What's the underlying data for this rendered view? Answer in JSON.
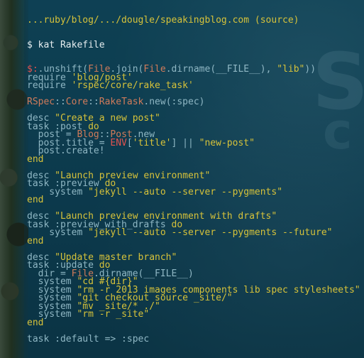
{
  "terminal": {
    "top_line": "...ruby/blog/.../dougle/speakingblog.com (source)",
    "prompt": "$ kat Rakefile",
    "lines": [
      "$:.unshift(File.join(File.dirname(__FILE__), \"lib\"))",
      "require 'blog/post'",
      "require 'rspec/core/rake_task'",
      "",
      "RSpec::Core::RakeTask.new(:spec)",
      "",
      "desc \"Create a new post\"",
      "task :post do",
      "  post = Blog::Post.new",
      "  post.title = ENV['title'] || \"new-post\"",
      "  post.create!",
      "end",
      "",
      "desc \"Launch preview environment\"",
      "task :preview do",
      "    system \"jekyll --auto --server --pygments\"",
      "end",
      "",
      "desc \"Launch preview environment with drafts\"",
      "task :preview_with_drafts do",
      "    system \"jekyll --auto --server --pygments --future\"",
      "end",
      "",
      "desc \"Update master branch\"",
      "task :update do",
      "  dir = File.dirname(__FILE__)",
      "  system \"cd #{dir}\"",
      "  system \"rm -r 2013 images components lib spec stylesheets\"",
      "  system \"git checkout source _site/\"",
      "  system \"mv _site/* ./\"",
      "  system \"rm -r _site\"",
      "end",
      "",
      "task :default => :spec"
    ]
  },
  "colors": {
    "background": "#0e3a4a",
    "string": "#d6c23a",
    "constant": "#d07b5a",
    "env": "#e2534f",
    "text": "#8fb7c4"
  }
}
